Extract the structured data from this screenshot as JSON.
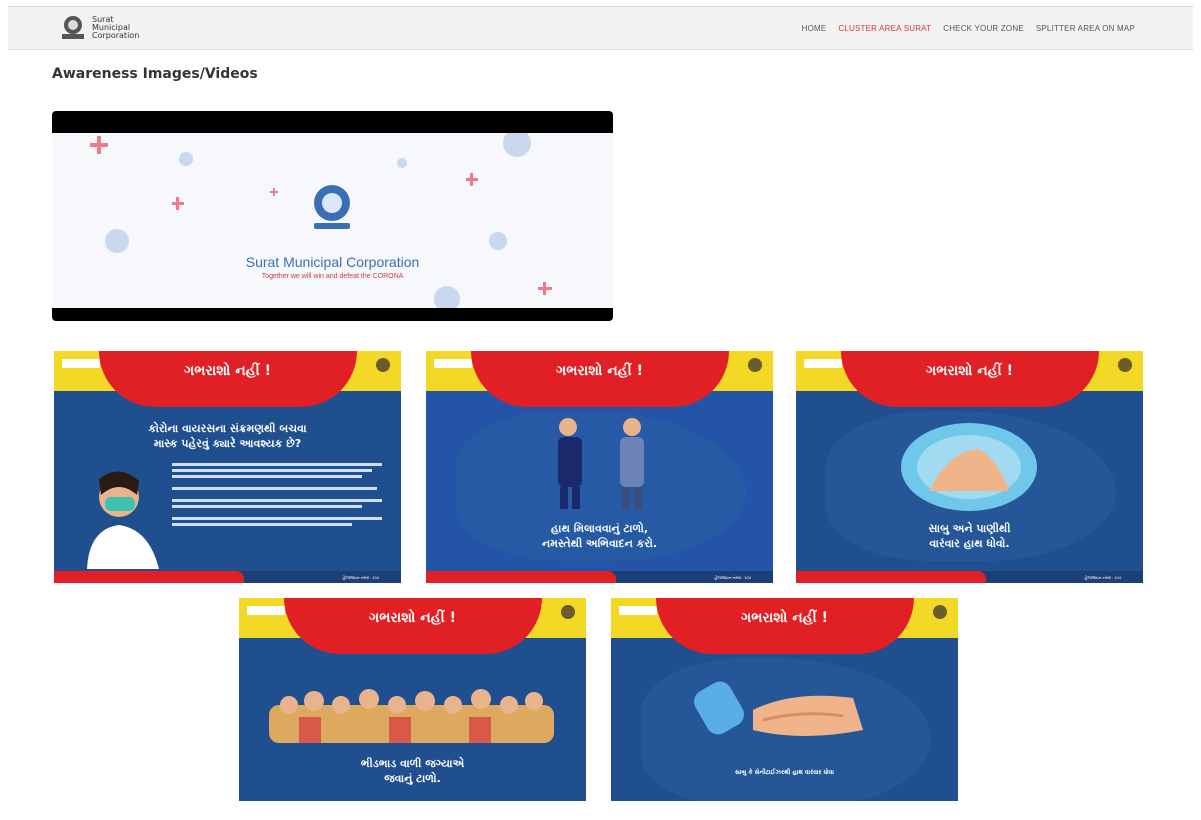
{
  "header": {
    "logo_text": [
      "Surat",
      "Municipal",
      "Corporation"
    ],
    "nav": [
      "HOME",
      "CLUSTER AREA SURAT",
      "CHECK YOUR ZONE",
      "SPLITTER AREA ON MAP"
    ],
    "active_index": 1
  },
  "page_title": "Awareness Images/Videos",
  "video": {
    "brand": "Surat Municipal Corporation",
    "tagline": "Together we will win and defeat the CORONA"
  },
  "posters": [
    {
      "title": "ગભરાશો નહીં !",
      "caption": [
        "કોરોના વાયરસના સંક્રમણથી બચવા",
        "માસ્ક પહેરવું ક્યારે આવશ્યક છે?"
      ],
      "footer_right": "હેલ્પલાઇન નંબર : 104"
    },
    {
      "title": "ગભરાશો નહીં !",
      "caption": [
        "હાથ મિલાવવાનું ટાળો,",
        "નમસ્તેથી અભિવાદન કરો."
      ],
      "footer_right": "હેલ્પલાઇન નંબર : 104"
    },
    {
      "title": "ગભરાશો નહીં !",
      "caption": [
        "સાબુ અને પાણીથી",
        "વારંવાર હાથ ધોવો."
      ],
      "footer_right": "હેલ્પલાઇન નંબર : 104"
    },
    {
      "title": "ગભરાશો નહીં !",
      "caption": [
        "ભીડભાડ વાળી જગ્યાએ",
        "જવાનું ટાળો."
      ],
      "footer_right": ""
    },
    {
      "title": "ગભરાશો નહીં !",
      "caption": [
        "સાબુ કે સેનીટાઈઝરથી હાથ વારંવાર ધોવા",
        ""
      ],
      "footer_right": ""
    }
  ]
}
